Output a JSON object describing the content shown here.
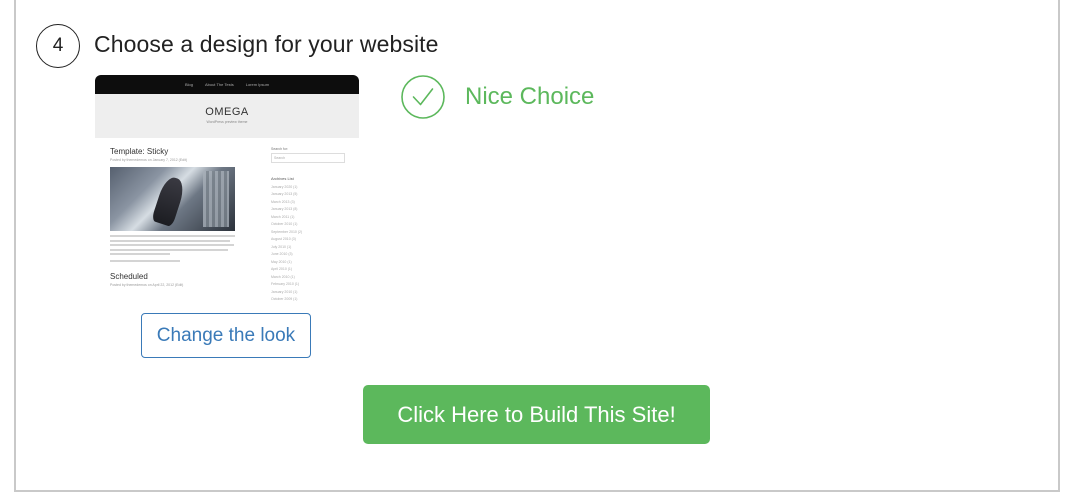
{
  "step": {
    "number": "4",
    "title": "Choose a design for your website"
  },
  "preview": {
    "nav": [
      "Blog",
      "About The Tests",
      "Lorem Ipsum"
    ],
    "site_title": "OMEGA",
    "tagline": "WordPress preview theme",
    "post1_title": "Template: Sticky",
    "post1_meta": "Posted by themedemos on January 7, 2012 (Edit)",
    "post2_title": "Scheduled",
    "post2_meta": "Posted by themedemos on April 22, 2012 (Edit)",
    "search_label": "Search for:",
    "search_placeholder": "Search",
    "archives_title": "Archives List",
    "archives": [
      "January 2020 (1)",
      "January 2013 (5)",
      "March 2013 (3)",
      "January 2013 (8)",
      "March 2011 (1)",
      "October 2010 (1)",
      "September 2010 (2)",
      "August 2010 (3)",
      "July 2010 (1)",
      "June 2010 (3)",
      "May 2010 (1)",
      "April 2010 (1)",
      "March 2010 (1)",
      "February 2010 (1)",
      "January 2010 (1)",
      "October 2009 (1)"
    ]
  },
  "status": {
    "label": "Nice Choice",
    "color": "#5cb85c"
  },
  "buttons": {
    "change_look": "Change the look",
    "build": "Click Here to Build This Site!"
  }
}
